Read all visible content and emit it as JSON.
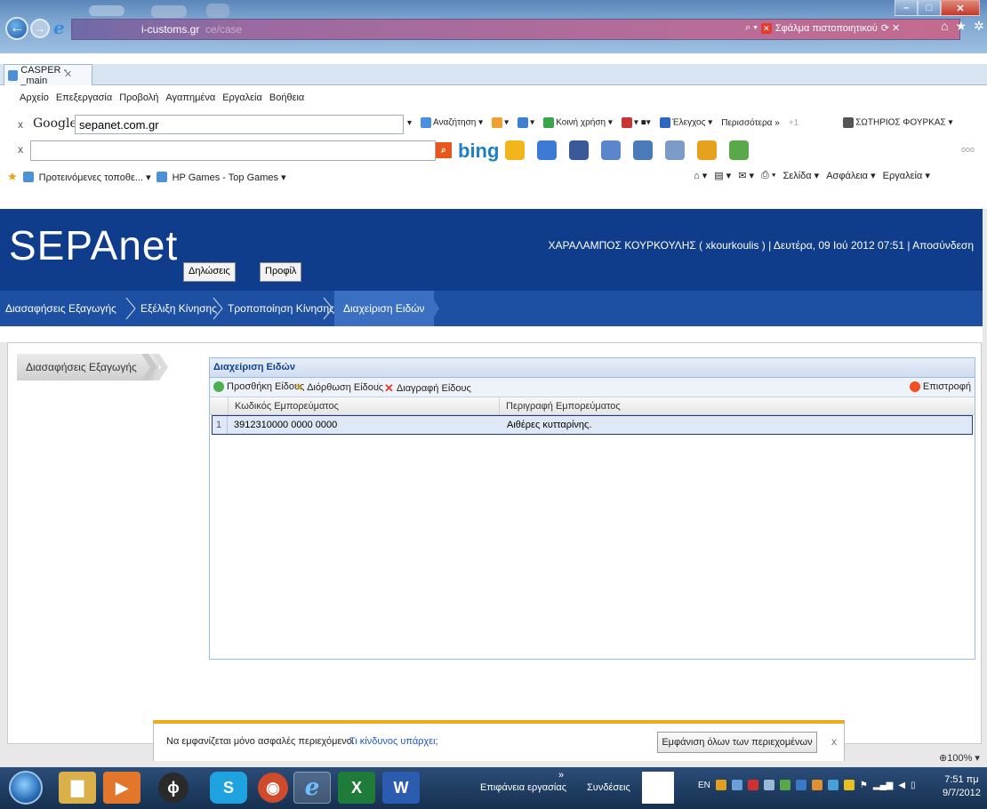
{
  "browser": {
    "address_domain": "i-customs.gr",
    "address_rest": "ce/case",
    "cert_error": "Σφάλμα πιστοποιητικού",
    "tab_title": "CASPER - _main",
    "menu": [
      "Αρχείο",
      "Επεξεργασία",
      "Προβολή",
      "Αγαπημένα",
      "Εργαλεία",
      "Βοήθεια"
    ],
    "google_label": "Google",
    "google_query": "sepanet.com.gr",
    "google_tools": [
      "Αναζήτηση ▾",
      "Κοινή χρήση ▾",
      "Έλεγχος ▾",
      "Περισσότερα »",
      "ΣΩΤΗΡΙΟΣ ΦΟΥΡΚΑΣ ▾"
    ],
    "bing_label": "bing",
    "bing_more": "ooo",
    "favorites": [
      "Προτεινόμενες τοποθε... ▾",
      "HP Games - Top Games ▾"
    ],
    "command_bar": [
      "Σελίδα ▾",
      "Ασφάλεια ▾",
      "Εργαλεία ▾"
    ],
    "zoom": "100%"
  },
  "site": {
    "logo": "SEPAnet",
    "header_buttons": [
      "Δηλώσεις",
      "Προφίλ"
    ],
    "user_info": "ΧΑΡΑΛΑΜΠΟΣ ΚΟΥΡΚΟΥΛΗΣ ( xkourkoulis ) | Δευτέρα, 09 Ιού 2012 07:51 | Αποσύνδεση",
    "breadcrumbs": [
      "Διασαφήσεις Εξαγωγής",
      "Εξέλιξη Κίνησης",
      "Τροποποίηση Κίνησης",
      "Διαχείριση Ειδών"
    ],
    "side_menu": "Διασαφήσεις Εξαγωγής"
  },
  "grid": {
    "title": "Διαχείριση Ειδών",
    "add": "Προσθήκη Είδους",
    "edit": "Διόρθωση Είδους",
    "delete": "Διαγραφή Είδους",
    "back": "Επιστροφή",
    "columns": [
      "Κωδικός Εμπορεύματος",
      "Περιγραφή Εμπορεύματος"
    ],
    "rows": [
      {
        "num": "1",
        "code": "3912310000 0000 0000",
        "desc": "Αιθέρες κυτταρίνης."
      }
    ]
  },
  "infobar": {
    "message": "Να εμφανίζεται μόνο ασφαλές περιεχόμενο.",
    "link": "Τι κίνδυνος υπάρχει;",
    "button": "Εμφάνιση όλων των περιεχομένων",
    "close": "x"
  },
  "taskbar": {
    "desktop_label": "Επιφάνεια εργασίας",
    "connections_label": "Συνδέσεις",
    "lang": "EN",
    "time": "7:51 πμ",
    "date": "9/7/2012"
  }
}
